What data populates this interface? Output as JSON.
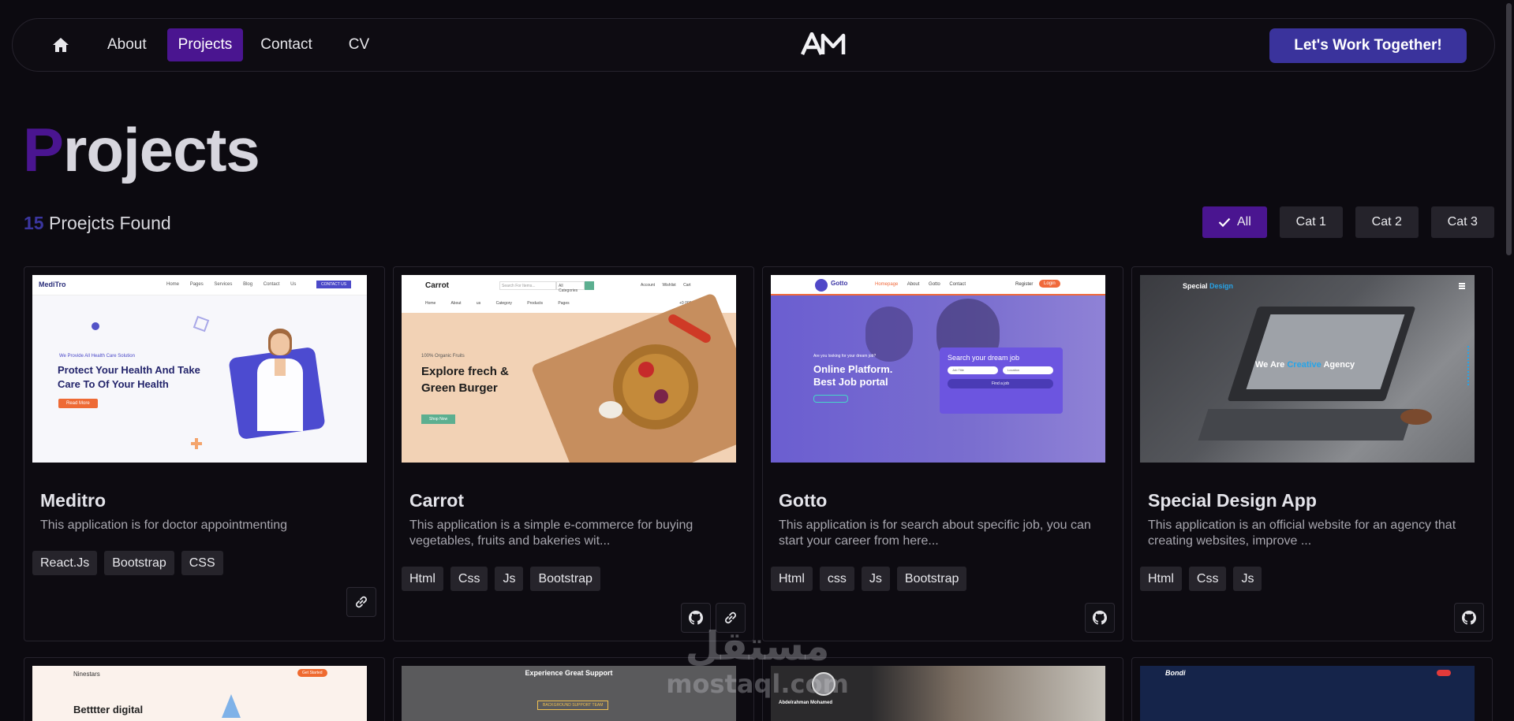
{
  "nav": {
    "links": [
      "About",
      "Projects",
      "Contact",
      "CV"
    ],
    "active": "Projects",
    "logo_text": "AM",
    "cta_label": "Let's Work Together!"
  },
  "heading": {
    "first_letter": "P",
    "rest": "rojects"
  },
  "found": {
    "count": "15",
    "label": "Proejcts Found"
  },
  "filters": [
    {
      "label": "All",
      "active": true
    },
    {
      "label": "Cat 1",
      "active": false
    },
    {
      "label": "Cat 2",
      "active": false
    },
    {
      "label": "Cat 3",
      "active": false
    }
  ],
  "projects": [
    {
      "title": "Meditro",
      "description": "This application is for doctor appointmenting",
      "tags": [
        "React.Js",
        "Bootstrap",
        "CSS"
      ],
      "actions": [
        "link-icon"
      ],
      "thumbnail": {
        "brand": "MediTro",
        "nav": [
          "Home",
          "Pages",
          "Services",
          "Blog",
          "Contact Us"
        ],
        "button": "CONTACT US",
        "tagline": "We Provide All Health Care Solution",
        "headline": [
          "Protect Your Health And Take",
          "Care To Of Your Health"
        ],
        "cta": "Read More"
      }
    },
    {
      "title": "Carrot",
      "description": "This application is a simple e-commerce for buying vegetables, fruits and bakeries wit...",
      "tags": [
        "Html",
        "Css",
        "Js",
        "Bootstrap"
      ],
      "actions": [
        "github-icon",
        "link-icon"
      ],
      "thumbnail": {
        "brand": "Carrot",
        "search_placeholder": "Search For Items...",
        "category": "All Categories",
        "nav": [
          "Home",
          "About us",
          "Category",
          "Products",
          "Pages"
        ],
        "util": [
          "Account",
          "Wishlist",
          "Cart"
        ],
        "phone": "+0 000 000 00",
        "tagline": "100% Organic Fruits",
        "headline": [
          "Explore frech &",
          "Green Burger"
        ],
        "cta": "Shop Now"
      }
    },
    {
      "title": "Gotto",
      "description": "This application is for search about specific job, you can start your career from here...",
      "tags": [
        "Html",
        "css",
        "Js",
        "Bootstrap"
      ],
      "actions": [
        "github-icon"
      ],
      "thumbnail": {
        "brand": "Gotto",
        "nav": [
          "Homepage",
          "About Gotto",
          "Contact"
        ],
        "register": "Register",
        "login": "Login",
        "tagline": "Are you looking for your dream job?",
        "headline": [
          "Online Platform.",
          "Best Job portal"
        ],
        "panel_title": "Search your dream job",
        "job_placeholder": "Job Title",
        "location_placeholder": "Location",
        "find_btn": "Find a job"
      }
    },
    {
      "title": "Special Design App",
      "description": "This application is an official website for an agency that creating websites, improve ...",
      "tags": [
        "Html",
        "Css",
        "Js"
      ],
      "actions": [
        "github-icon"
      ],
      "thumbnail": {
        "brand_a": "Special",
        "brand_b": "Design",
        "headline_a": "We Are",
        "headline_b": "Creative",
        "headline_c": "Agency"
      }
    }
  ],
  "second_row": [
    {
      "thumb_brand": "Ninestars",
      "thumb_headline": "Betttter digital",
      "thumb_button": "Get Started"
    },
    {
      "thumb_headline": "Experience Great Support",
      "thumb_button": "BACKGROUND SUPPORT TEAM"
    },
    {
      "thumb_name": "Abdelrahman Mohamed"
    },
    {
      "thumb_brand": "Bondi"
    }
  ],
  "watermark": {
    "arabic": "مستقل",
    "latin": "mostaql.com"
  },
  "colors": {
    "accent": "#4a1590",
    "cta": "#3a339c",
    "background": "#0c0a10"
  }
}
